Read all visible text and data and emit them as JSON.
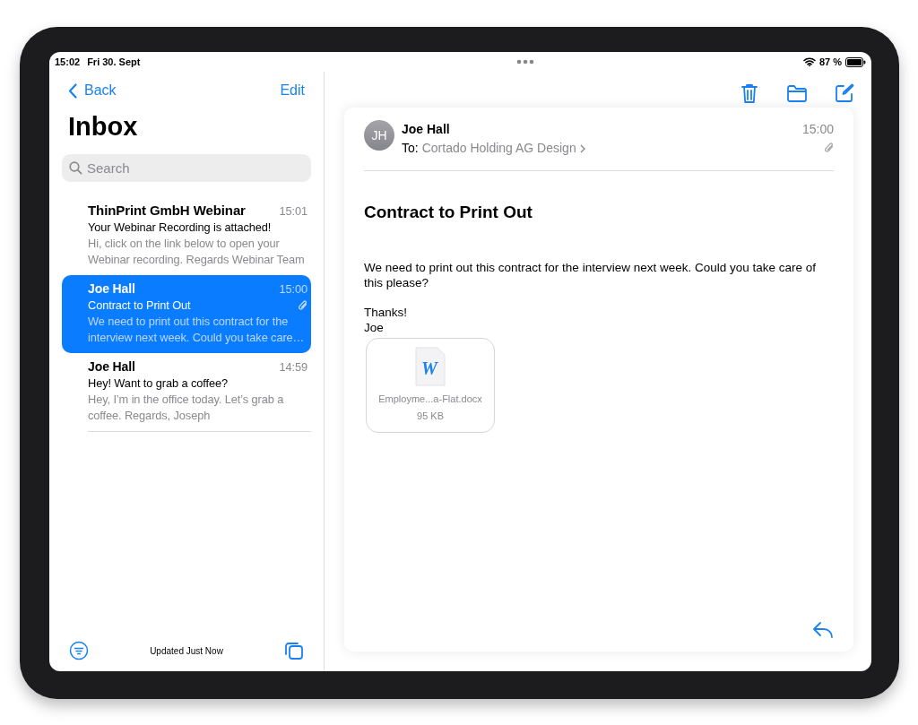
{
  "status_bar": {
    "time": "15:02",
    "date": "Fri 30. Sept",
    "battery_text": "87 %"
  },
  "sidebar": {
    "back": "Back",
    "edit": "Edit",
    "title": "Inbox",
    "search": {
      "placeholder": "Search"
    },
    "messages": [
      {
        "sender": "ThinPrint GmbH Webinar",
        "time": "15:01",
        "subject": "Your Webinar Recording is attached!",
        "preview": "Hi, click on the link below to open your Webinar recording. Regards Webinar Team",
        "selected": false,
        "attachment": false
      },
      {
        "sender": "Joe Hall",
        "time": "15:00",
        "subject": "Contract to Print Out",
        "preview": "We need to print out this contract for the interview next week. Could you take care…",
        "selected": true,
        "attachment": true
      },
      {
        "sender": "Joe Hall",
        "time": "14:59",
        "subject": "Hey! Want to grab a coffee?",
        "preview": "Hey, I’m in the office today. Let’s grab a coffee. Regards, Joseph",
        "selected": false,
        "attachment": false
      }
    ],
    "footer": "Updated Just Now"
  },
  "message": {
    "initials": "JH",
    "sender": "Joe Hall",
    "to_label": "To:",
    "recipient": "Cortado Holding AG Design",
    "time": "15:00",
    "attachment": true,
    "subject": "Contract to Print Out",
    "body": [
      "We need to print out this contract for the interview next week. Could you take care of this please?",
      "Thanks!",
      "Joe"
    ],
    "file": {
      "icon_letter": "W",
      "name": "Employme...a-Flat.docx",
      "size": "95 KB"
    }
  }
}
